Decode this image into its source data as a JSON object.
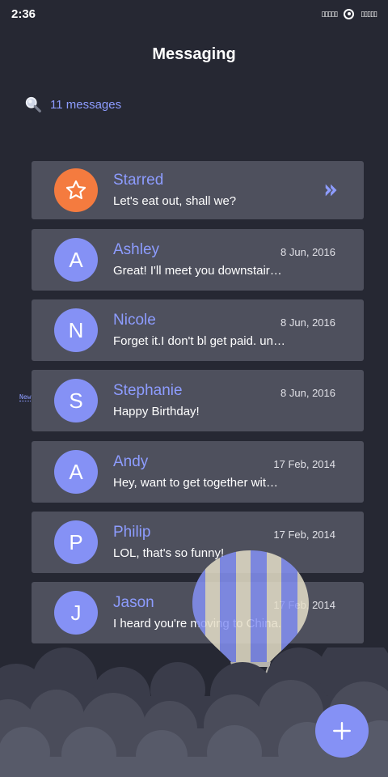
{
  "status_bar": {
    "time": "2:36",
    "left_icons": "▯▯▯▯▯",
    "right_icons": "▯▯▯▯▯"
  },
  "header": {
    "title": "Messaging"
  },
  "search": {
    "count_label": "11 messages",
    "icon": "search-icon"
  },
  "badge": {
    "new_label": "New"
  },
  "conversations": [
    {
      "avatar": "☆",
      "name": "Starred",
      "date": "",
      "preview": "Let's eat out, shall we?",
      "starred": true
    },
    {
      "avatar": "A",
      "name": "Ashley",
      "date": "8 Jun, 2016",
      "preview": "Great! I'll meet you downstair…"
    },
    {
      "avatar": "N",
      "name": "Nicole",
      "date": "8 Jun, 2016",
      "preview": "Forget it.I don't bl get paid. un…"
    },
    {
      "avatar": "S",
      "name": "Stephanie",
      "date": "8 Jun, 2016",
      "preview": "Happy Birthday!"
    },
    {
      "avatar": "A",
      "name": "Andy",
      "date": "17 Feb, 2014",
      "preview": "Hey, want to get together wit…"
    },
    {
      "avatar": "P",
      "name": "Philip",
      "date": "17 Feb, 2014",
      "preview": "LOL, that's so funny!"
    },
    {
      "avatar": "J",
      "name": "Jason",
      "date": "17 Feb, 2014",
      "preview": "I heard you're moving to China."
    }
  ],
  "colors": {
    "background": "#262833",
    "card": "#4e505d",
    "accent": "#8d9cff",
    "avatar": "#8591f5",
    "starred_avatar": "#f47b3f"
  }
}
